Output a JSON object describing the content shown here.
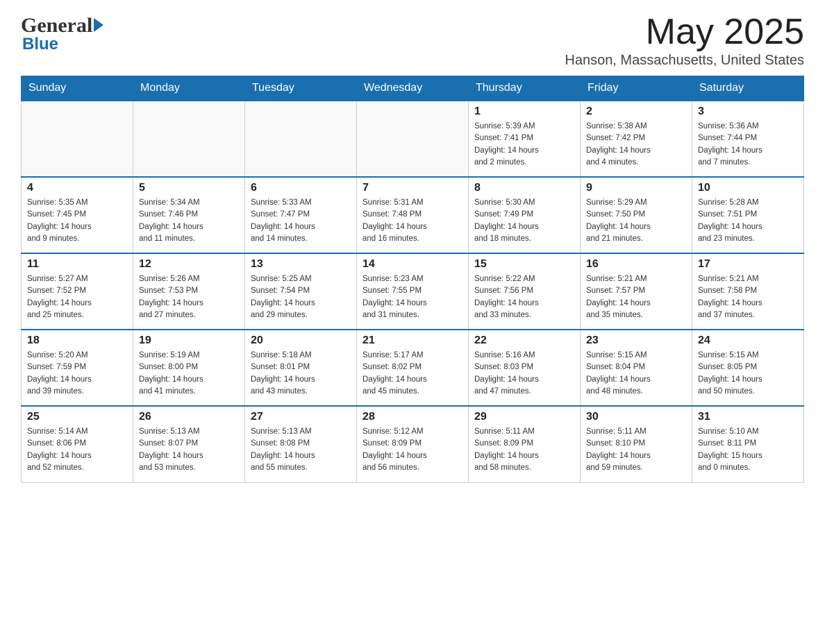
{
  "header": {
    "logo_general": "General",
    "logo_blue": "Blue",
    "month_title": "May 2025",
    "location": "Hanson, Massachusetts, United States"
  },
  "calendar": {
    "days_of_week": [
      "Sunday",
      "Monday",
      "Tuesday",
      "Wednesday",
      "Thursday",
      "Friday",
      "Saturday"
    ],
    "weeks": [
      [
        {
          "day": "",
          "info": ""
        },
        {
          "day": "",
          "info": ""
        },
        {
          "day": "",
          "info": ""
        },
        {
          "day": "",
          "info": ""
        },
        {
          "day": "1",
          "info": "Sunrise: 5:39 AM\nSunset: 7:41 PM\nDaylight: 14 hours\nand 2 minutes."
        },
        {
          "day": "2",
          "info": "Sunrise: 5:38 AM\nSunset: 7:42 PM\nDaylight: 14 hours\nand 4 minutes."
        },
        {
          "day": "3",
          "info": "Sunrise: 5:36 AM\nSunset: 7:44 PM\nDaylight: 14 hours\nand 7 minutes."
        }
      ],
      [
        {
          "day": "4",
          "info": "Sunrise: 5:35 AM\nSunset: 7:45 PM\nDaylight: 14 hours\nand 9 minutes."
        },
        {
          "day": "5",
          "info": "Sunrise: 5:34 AM\nSunset: 7:46 PM\nDaylight: 14 hours\nand 11 minutes."
        },
        {
          "day": "6",
          "info": "Sunrise: 5:33 AM\nSunset: 7:47 PM\nDaylight: 14 hours\nand 14 minutes."
        },
        {
          "day": "7",
          "info": "Sunrise: 5:31 AM\nSunset: 7:48 PM\nDaylight: 14 hours\nand 16 minutes."
        },
        {
          "day": "8",
          "info": "Sunrise: 5:30 AM\nSunset: 7:49 PM\nDaylight: 14 hours\nand 18 minutes."
        },
        {
          "day": "9",
          "info": "Sunrise: 5:29 AM\nSunset: 7:50 PM\nDaylight: 14 hours\nand 21 minutes."
        },
        {
          "day": "10",
          "info": "Sunrise: 5:28 AM\nSunset: 7:51 PM\nDaylight: 14 hours\nand 23 minutes."
        }
      ],
      [
        {
          "day": "11",
          "info": "Sunrise: 5:27 AM\nSunset: 7:52 PM\nDaylight: 14 hours\nand 25 minutes."
        },
        {
          "day": "12",
          "info": "Sunrise: 5:26 AM\nSunset: 7:53 PM\nDaylight: 14 hours\nand 27 minutes."
        },
        {
          "day": "13",
          "info": "Sunrise: 5:25 AM\nSunset: 7:54 PM\nDaylight: 14 hours\nand 29 minutes."
        },
        {
          "day": "14",
          "info": "Sunrise: 5:23 AM\nSunset: 7:55 PM\nDaylight: 14 hours\nand 31 minutes."
        },
        {
          "day": "15",
          "info": "Sunrise: 5:22 AM\nSunset: 7:56 PM\nDaylight: 14 hours\nand 33 minutes."
        },
        {
          "day": "16",
          "info": "Sunrise: 5:21 AM\nSunset: 7:57 PM\nDaylight: 14 hours\nand 35 minutes."
        },
        {
          "day": "17",
          "info": "Sunrise: 5:21 AM\nSunset: 7:58 PM\nDaylight: 14 hours\nand 37 minutes."
        }
      ],
      [
        {
          "day": "18",
          "info": "Sunrise: 5:20 AM\nSunset: 7:59 PM\nDaylight: 14 hours\nand 39 minutes."
        },
        {
          "day": "19",
          "info": "Sunrise: 5:19 AM\nSunset: 8:00 PM\nDaylight: 14 hours\nand 41 minutes."
        },
        {
          "day": "20",
          "info": "Sunrise: 5:18 AM\nSunset: 8:01 PM\nDaylight: 14 hours\nand 43 minutes."
        },
        {
          "day": "21",
          "info": "Sunrise: 5:17 AM\nSunset: 8:02 PM\nDaylight: 14 hours\nand 45 minutes."
        },
        {
          "day": "22",
          "info": "Sunrise: 5:16 AM\nSunset: 8:03 PM\nDaylight: 14 hours\nand 47 minutes."
        },
        {
          "day": "23",
          "info": "Sunrise: 5:15 AM\nSunset: 8:04 PM\nDaylight: 14 hours\nand 48 minutes."
        },
        {
          "day": "24",
          "info": "Sunrise: 5:15 AM\nSunset: 8:05 PM\nDaylight: 14 hours\nand 50 minutes."
        }
      ],
      [
        {
          "day": "25",
          "info": "Sunrise: 5:14 AM\nSunset: 8:06 PM\nDaylight: 14 hours\nand 52 minutes."
        },
        {
          "day": "26",
          "info": "Sunrise: 5:13 AM\nSunset: 8:07 PM\nDaylight: 14 hours\nand 53 minutes."
        },
        {
          "day": "27",
          "info": "Sunrise: 5:13 AM\nSunset: 8:08 PM\nDaylight: 14 hours\nand 55 minutes."
        },
        {
          "day": "28",
          "info": "Sunrise: 5:12 AM\nSunset: 8:09 PM\nDaylight: 14 hours\nand 56 minutes."
        },
        {
          "day": "29",
          "info": "Sunrise: 5:11 AM\nSunset: 8:09 PM\nDaylight: 14 hours\nand 58 minutes."
        },
        {
          "day": "30",
          "info": "Sunrise: 5:11 AM\nSunset: 8:10 PM\nDaylight: 14 hours\nand 59 minutes."
        },
        {
          "day": "31",
          "info": "Sunrise: 5:10 AM\nSunset: 8:11 PM\nDaylight: 15 hours\nand 0 minutes."
        }
      ]
    ]
  }
}
